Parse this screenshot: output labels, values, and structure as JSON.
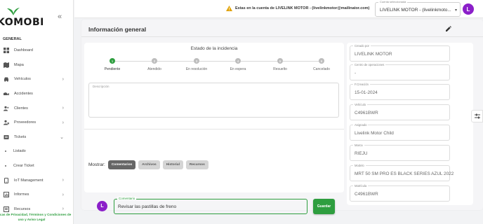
{
  "brand": {
    "name": "KOMOBI",
    "accent": "#2e9e3f",
    "avatar_color": "#8b1fc9"
  },
  "sidebar": {
    "section": "GENERAL",
    "items": [
      {
        "label": "Dashboard",
        "icon": "grid-icon",
        "chevron": ""
      },
      {
        "label": "Mapa",
        "icon": "map-icon",
        "chevron": ""
      },
      {
        "label": "Vehículos",
        "icon": "car-icon",
        "chevron": "›"
      },
      {
        "label": "Accidentes",
        "icon": "crash-icon",
        "chevron": ""
      },
      {
        "label": "Clientes",
        "icon": "users-icon",
        "chevron": "›"
      },
      {
        "label": "Proveedores",
        "icon": "provider-icon",
        "chevron": "›"
      },
      {
        "label": "Tickets",
        "icon": "ticket-icon",
        "chevron": "⌄"
      },
      {
        "label": "Listado",
        "icon": "dot",
        "chevron": ""
      },
      {
        "label": "Crear Ticket",
        "icon": "dot",
        "chevron": ""
      },
      {
        "label": "IoT Management",
        "icon": "iot-icon",
        "chevron": "›"
      },
      {
        "label": "Informes",
        "icon": "report-icon",
        "chevron": "›"
      },
      {
        "label": "Recursos",
        "icon": "resources-icon",
        "chevron": "›"
      }
    ],
    "footer": "Políticas de Privacidad, Términos y Condiciones de uso y Aviso Legal"
  },
  "topbar": {
    "warning": "Estas en la cuenta de LIVELINK MOTOR - (livelinkmotor@mailinator.com)",
    "company_label": "Cuenta seleccionada",
    "company_value": "LIVELINK MOTOR - (livelinkmoto...",
    "avatar_letter": "L"
  },
  "main": {
    "title": "Información general",
    "status_title": "Estado de la incidencia",
    "steps": [
      {
        "num": "1",
        "label": "Pendiente"
      },
      {
        "num": "2",
        "label": "Atendido"
      },
      {
        "num": "3",
        "label": "En resolución"
      },
      {
        "num": "4",
        "label": "En espera"
      },
      {
        "num": "5",
        "label": "Resuelto"
      },
      {
        "num": "6",
        "label": "Cancelado"
      }
    ],
    "active_step": 1,
    "description_label": "Descripción",
    "show_label": "Mostrar:",
    "tabs": [
      "Comentarios",
      "Archivos",
      "Historial",
      "Recursos"
    ],
    "comment": {
      "avatar_letter": "L",
      "label": "Comentario",
      "value": "Revisar las pastillas de freno",
      "save": "Guardar"
    }
  },
  "details": [
    {
      "label": "Creado por",
      "value": "LIVELINK MOTOR"
    },
    {
      "label": "Centro de operaciones",
      "value": "-"
    },
    {
      "label": "F.Creación",
      "value": "15-01-2024"
    },
    {
      "label": "Vehículo",
      "value": "C4961BWR"
    },
    {
      "label": "Asignado",
      "value": "Livelink Motor Child"
    },
    {
      "label": "Marca",
      "value": "RIEJU"
    },
    {
      "label": "Modelo",
      "value": "MRT 50 SM PRO ES BLACK SERIES AZUL 2022"
    },
    {
      "label": "Matrícula",
      "value": "C4961BWR"
    }
  ]
}
